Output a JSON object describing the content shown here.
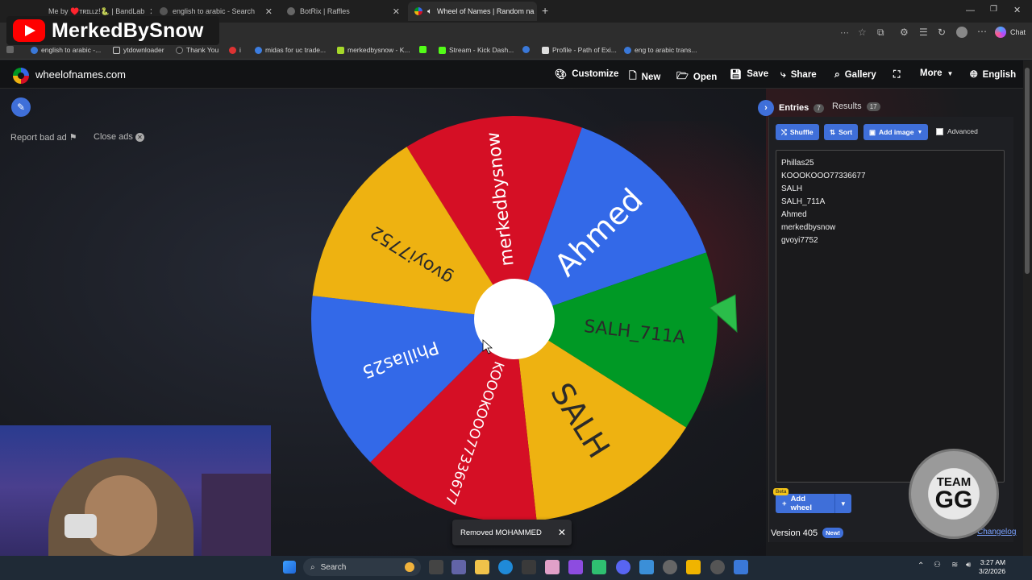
{
  "browser": {
    "tabs": [
      {
        "title": "Me by ♥️ᴛʀɪʟʟᴢ!🐍 | BandLab",
        "active": false
      },
      {
        "title": "english to arabic - Search",
        "active": false
      },
      {
        "title": "BotRix | Raffles",
        "active": false
      },
      {
        "title": "Wheel of Names | Random na",
        "active": true
      }
    ],
    "new_tab": "+",
    "chat_label": "Chat",
    "bookmarks": [
      "english to arabic -...",
      "ytdownloader",
      "Thank You",
      "i",
      "midas for uc trade...",
      "merkedbysnow - K...",
      "Stream - Kick Dash...",
      "Profile - Path of Exi...",
      "eng to arabic trans..."
    ]
  },
  "overlay": {
    "channel_name": "MerkedBySnow",
    "badge": "TEAM",
    "badge_big": "GG"
  },
  "site": {
    "name": "wheelofnames.com",
    "menu": [
      {
        "label": "Customize",
        "icon": "palette-icon"
      },
      {
        "label": "New",
        "icon": "file-icon"
      },
      {
        "label": "Open",
        "icon": "folder-icon"
      },
      {
        "label": "Save",
        "icon": "save-icon"
      },
      {
        "label": "Share",
        "icon": "share-icon"
      },
      {
        "label": "Gallery",
        "icon": "search-icon"
      },
      {
        "label": "",
        "icon": "fullscreen-icon"
      },
      {
        "label": "More",
        "icon": "chevron-down-icon"
      },
      {
        "label": "English",
        "icon": "globe-icon"
      }
    ],
    "report_ad": "Report bad ad",
    "close_ads": "Close ads"
  },
  "wheel": {
    "segments": [
      {
        "label": "merkedbysnow",
        "color": "#d50f25"
      },
      {
        "label": "Ahmed",
        "color": "#3369e8"
      },
      {
        "label": "SALH_711A",
        "color": "#009925"
      },
      {
        "label": "SALH",
        "color": "#eeb211"
      },
      {
        "label": "KOOOKOOO77336677",
        "color": "#d50f25"
      },
      {
        "label": "Phillas25",
        "color": "#3369e8"
      },
      {
        "label": "gvoyi7752",
        "color": "#eeb211"
      }
    ],
    "pointer_color": "#2bbd4a"
  },
  "panel": {
    "tab_entries": "Entries",
    "entries_count": "7",
    "tab_results": "Results",
    "results_count": "17",
    "shuffle": "Shuffle",
    "sort": "Sort",
    "add_image": "Add image",
    "advanced": "Advanced",
    "entries": [
      "Phillas25",
      "KOOOKOOO77336677",
      "SALH",
      "SALH_711A",
      "Ahmed",
      "merkedbysnow",
      "gvoyi7752"
    ],
    "beta": "Beta",
    "add_wheel": "Add wheel",
    "version": "Version 405",
    "new_badge": "New!",
    "changelog": "Changelog"
  },
  "toast": {
    "message": "Removed MOHAMMED",
    "close": "✕"
  },
  "taskbar": {
    "search": "Search",
    "time": "3:27 AM",
    "date": "3/2/2026"
  }
}
